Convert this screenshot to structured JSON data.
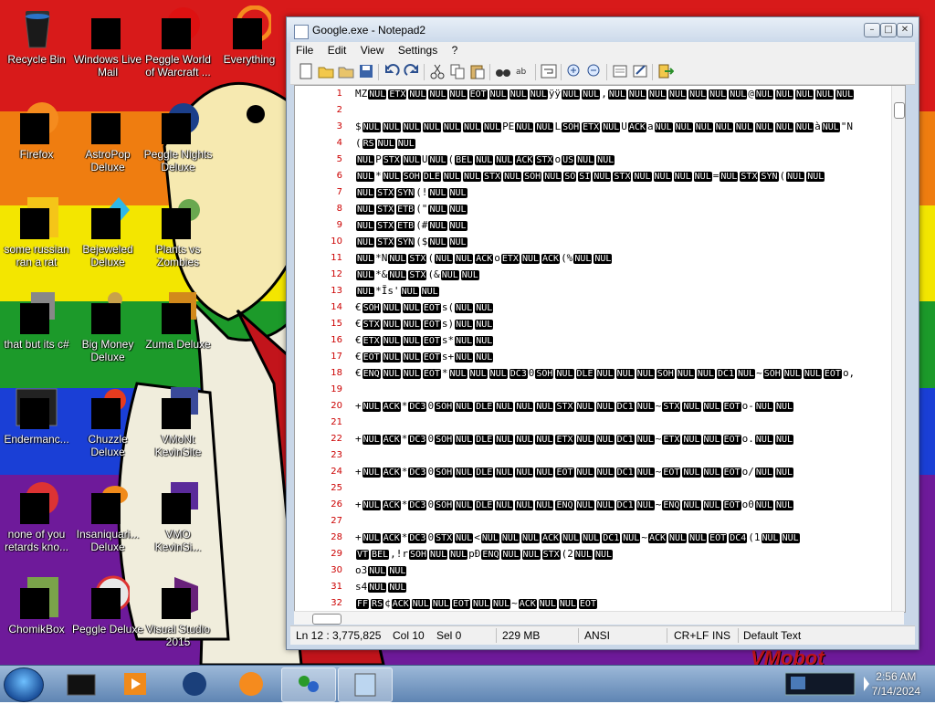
{
  "desktop": {
    "icons": [
      {
        "label": "Recycle Bin"
      },
      {
        "label": "Windows Live Mail"
      },
      {
        "label": "Peggle World of Warcraft ..."
      },
      {
        "label": "Everything"
      },
      {
        "label": "Firefox"
      },
      {
        "label": "AstroPop Deluxe"
      },
      {
        "label": "Peggle Nights Deluxe"
      },
      {
        "label": "some russian ran a rat"
      },
      {
        "label": "Bejeweled Deluxe"
      },
      {
        "label": "Plants vs Zombies"
      },
      {
        "label": "that but its c#"
      },
      {
        "label": "Big Money Deluxe"
      },
      {
        "label": "Zuma Deluxe"
      },
      {
        "label": "Endermanc..."
      },
      {
        "label": "Chuzzle Deluxe"
      },
      {
        "label": "VMoNt KevinSite"
      },
      {
        "label": "none of you retards kno..."
      },
      {
        "label": "Insaniquari... Deluxe"
      },
      {
        "label": "VMO KevinSi..."
      },
      {
        "label": "ChomikBox"
      },
      {
        "label": "Peggle Deluxe"
      },
      {
        "label": "Visual Studio 2015"
      }
    ],
    "wallpaper_text": "VMobot"
  },
  "window": {
    "title": "Google.exe - Notepad2",
    "menu": [
      "File",
      "Edit",
      "View",
      "Settings",
      "?"
    ],
    "lines": [
      {
        "n": "1",
        "text": "MZ NUL ETX NUL NUL NUL EOT NUL NUL NUL ÿÿ NUL NUL , NUL NUL NUL NUL NUL NUL NUL @ NUL NUL NUL NUL NUL"
      },
      {
        "n": "2",
        "text": ""
      },
      {
        "n": "3",
        "text": "$ NUL NUL NUL NUL NUL NUL NUL PE NUL NUL L SOH ETX NUL U ACK a NUL NUL NUL NUL NUL NUL NUL NUL à NUL \" N"
      },
      {
        "n": "4",
        "text": "( RS NUL NUL"
      },
      {
        "n": "5",
        "text": "NUL P STX NUL U NUL ( BEL NUL NUL ACK STX o US NUL NUL"
      },
      {
        "n": "6",
        "text": "NUL * NUL SOH DLE NUL NUL STX NUL SOH NUL SO SI NUL STX NUL NUL NUL NUL = NUL STX SYN ( NUL NUL"
      },
      {
        "n": "7",
        "text": "NUL STX SYN (! NUL NUL"
      },
      {
        "n": "8",
        "text": "NUL STX ETB (\" NUL NUL"
      },
      {
        "n": "9",
        "text": "NUL STX ETB (# NUL NUL"
      },
      {
        "n": "10",
        "text": "NUL STX SYN ($ NUL NUL"
      },
      {
        "n": "11",
        "text": "NUL * N NUL STX ( NUL NUL ACK o ETX NUL ACK (% NUL NUL"
      },
      {
        "n": "12",
        "text": "NUL * & NUL STX (& NUL NUL"
      },
      {
        "n": "13",
        "text": "NUL * Ĭ s' NUL NUL"
      },
      {
        "n": "14",
        "text": "€ SOH NUL NUL EOT s( NUL NUL"
      },
      {
        "n": "15",
        "text": "€ STX NUL NUL EOT s) NUL NUL"
      },
      {
        "n": "16",
        "text": "€ ETX NUL NUL EOT s* NUL NUL"
      },
      {
        "n": "17",
        "text": "€ EOT NUL NUL EOT s+ NUL NUL"
      },
      {
        "n": "18",
        "text": "€ ENQ NUL NUL EOT * NUL NUL NUL DC3 0 SOH NUL DLE NUL NUL NUL SOH NUL NUL DC1 NUL ~ SOH NUL NUL EOT o,"
      },
      {
        "n": "19",
        "text": ""
      },
      {
        "n": "20",
        "text": "+ NUL ACK * DC3 0 SOH NUL DLE NUL NUL NUL STX NUL NUL DC1 NUL ~ STX NUL NUL EOT o- NUL NUL"
      },
      {
        "n": "21",
        "text": ""
      },
      {
        "n": "22",
        "text": "+ NUL ACK * DC3 0 SOH NUL DLE NUL NUL NUL ETX NUL NUL DC1 NUL ~ ETX NUL NUL EOT o. NUL NUL"
      },
      {
        "n": "23",
        "text": ""
      },
      {
        "n": "24",
        "text": "+ NUL ACK * DC3 0 SOH NUL DLE NUL NUL NUL EOT NUL NUL DC1 NUL ~ EOT NUL NUL EOT o/ NUL NUL"
      },
      {
        "n": "25",
        "text": ""
      },
      {
        "n": "26",
        "text": "+ NUL ACK * DC3 0 SOH NUL DLE NUL NUL NUL ENQ NUL NUL DC1 NUL ~ ENQ NUL NUL EOT o0 NUL NUL"
      },
      {
        "n": "27",
        "text": ""
      },
      {
        "n": "28",
        "text": "+ NUL ACK * DC3 0 STX NUL < NUL NUL NUL ACK NUL NUL DC1 NUL ~ ACK NUL NUL EOT DC4 (1 NUL NUL"
      },
      {
        "n": "29",
        "text": "VT BEL ,!r SOH NUL NUL pÐ ENQ NUL NUL STX (2 NUL NUL"
      },
      {
        "n": "30",
        "text": "o3 NUL NUL"
      },
      {
        "n": "31",
        "text": "s4 NUL NUL"
      },
      {
        "n": "32",
        "text": "FF RS ¢ ACK NUL NUL EOT NUL NUL ~ ACK NUL NUL EOT"
      }
    ],
    "status": {
      "position": "Ln 12 : 3,775,825",
      "col": "Col 10",
      "sel": "Sel 0",
      "size": "229 MB",
      "encoding": "ANSI",
      "eol": "CR+LF",
      "mode": "INS",
      "scheme": "Default Text"
    }
  },
  "taskbar": {
    "time": "2:56 AM",
    "date": "7/14/2024"
  },
  "colors": {
    "ctrl_bg": "#000000",
    "ctrl_fg": "#ffffff",
    "line_number": "#cc0000"
  }
}
